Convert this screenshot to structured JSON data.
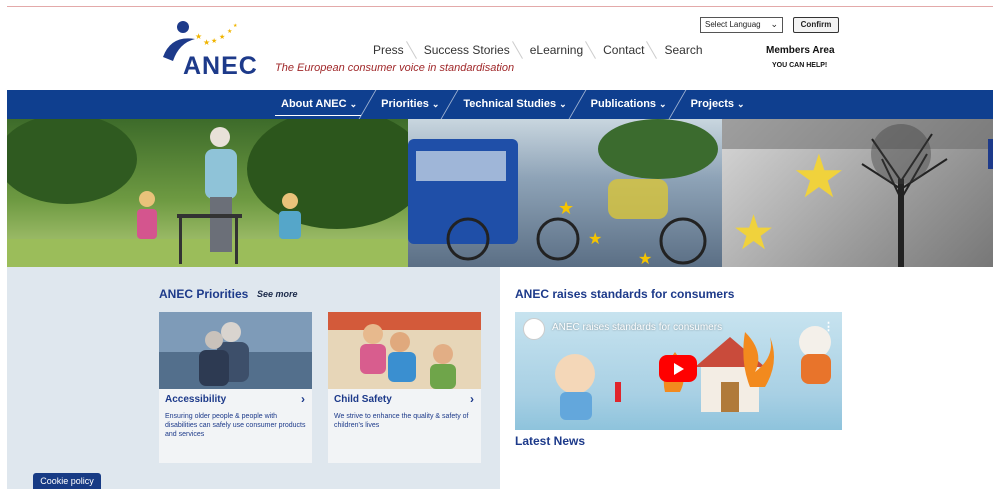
{
  "header": {
    "logo_text": "ANEC",
    "tagline": "The European consumer voice in standardisation",
    "top_nav": [
      "Press",
      "Success Stories",
      "eLearning",
      "Contact",
      "Search"
    ],
    "language_select": {
      "value": "Select Languag"
    },
    "confirm_label": "Confirm",
    "members_area": "Members Area",
    "you_can_help": "YOU CAN HELP!"
  },
  "main_nav": {
    "items": [
      {
        "label": "About ANEC",
        "active": true
      },
      {
        "label": "Priorities",
        "active": false
      },
      {
        "label": "Technical Studies",
        "active": false
      },
      {
        "label": "Publications",
        "active": false
      },
      {
        "label": "Projects",
        "active": false
      }
    ]
  },
  "priorities": {
    "title": "ANEC Priorities",
    "see_more": "See more",
    "cards": [
      {
        "title": "Accessibility",
        "description": "Ensuring older people & people with disabilities can safely use consumer products and services"
      },
      {
        "title": "Child Safety",
        "description": "We strive to enhance the quality & safety of children's lives"
      }
    ]
  },
  "video_section": {
    "title": "ANEC raises standards for consumers",
    "video_title": "ANEC raises standards for consumers"
  },
  "latest_news": {
    "title": "Latest News"
  },
  "cookie_policy": "Cookie policy",
  "colors": {
    "brand_blue": "#0f3f8f",
    "tagline_red": "#a0282a",
    "youtube_red": "#ff0000"
  }
}
